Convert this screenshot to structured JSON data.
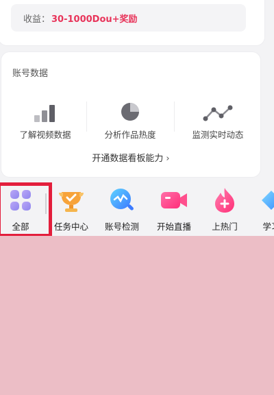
{
  "reward": {
    "label": "收益：",
    "value": "30-1000Dou+奖励"
  },
  "account_data": {
    "title": "账号数据",
    "metrics": [
      {
        "label": "了解视频数据",
        "icon": "bar-chart-icon"
      },
      {
        "label": "分析作品热度",
        "icon": "pie-chart-icon"
      },
      {
        "label": "监测实时动态",
        "icon": "line-trend-icon"
      }
    ],
    "open_board": "开通数据看板能力",
    "open_board_chevron": "›"
  },
  "tools": [
    {
      "label": "全部",
      "icon": "all-grid-icon"
    },
    {
      "label": "任务中心",
      "icon": "trophy-icon"
    },
    {
      "label": "账号检测",
      "icon": "account-check-icon"
    },
    {
      "label": "开始直播",
      "icon": "live-camera-icon"
    },
    {
      "label": "上热门",
      "icon": "hot-flame-icon"
    },
    {
      "label": "学习",
      "icon": "learn-icon"
    }
  ],
  "colors": {
    "accent": "#e8345a",
    "highlight": "#e31e3c",
    "overlay": "#ecbec6"
  }
}
